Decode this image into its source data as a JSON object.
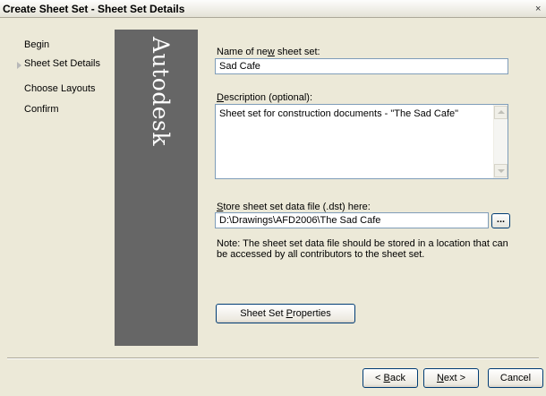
{
  "window": {
    "title": "Create Sheet Set - Sheet Set Details",
    "close_glyph": "×"
  },
  "steps": {
    "items": [
      {
        "label": "Begin"
      },
      {
        "label": "Sheet Set Details"
      },
      {
        "label": "Choose Layouts"
      },
      {
        "label": "Confirm"
      }
    ],
    "current_index": 1
  },
  "banner": {
    "brand": "Autodesk",
    "color": "#666666"
  },
  "form": {
    "name": {
      "label_before": "Name of ne",
      "label_mnemonic": "w",
      "label_after": " sheet set:",
      "value": "Sad Cafe"
    },
    "description": {
      "label_mnemonic": "D",
      "label_after": "escription (optional):",
      "value": "Sheet set for construction documents - \"The Sad Cafe\""
    },
    "store": {
      "label_mnemonic": "S",
      "label_after": "tore sheet set data file (.dst) here:",
      "value": "D:\\Drawings\\AFD2006\\The Sad Cafe",
      "browse_label": "..."
    },
    "note": "Note: The sheet set data file should be stored in a location that can be accessed by all contributors to the sheet set.",
    "properties_button": {
      "label_before": "Sheet Set ",
      "label_mnemonic": "P",
      "label_after": "roperties"
    }
  },
  "footer": {
    "back": {
      "prefix": "< ",
      "mnemonic": "B",
      "rest": "ack"
    },
    "next": {
      "mnemonic": "N",
      "rest": "ext >"
    },
    "cancel": "Cancel"
  },
  "icons": {
    "close": "close-icon",
    "current_step": "triangle-right-icon",
    "scroll_up": "scroll-up-arrow-icon",
    "scroll_down": "scroll-down-arrow-icon"
  }
}
